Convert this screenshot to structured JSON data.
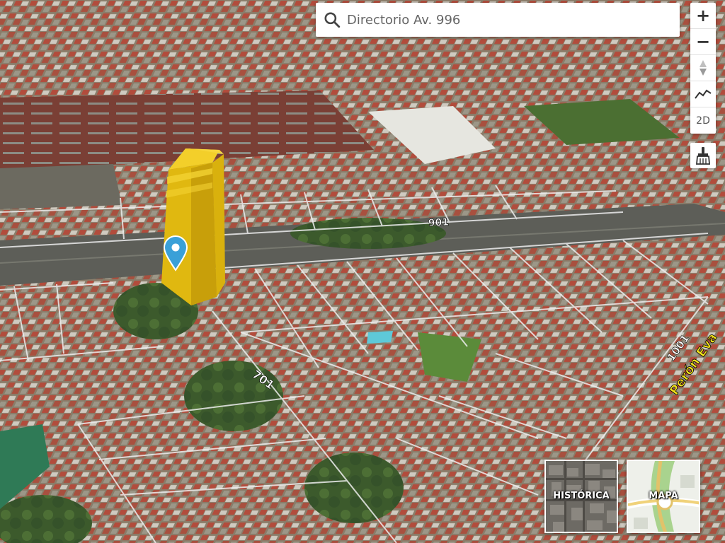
{
  "search": {
    "placeholder": "Directorio Av. 996"
  },
  "controls": {
    "zoom_in": "+",
    "zoom_out": "−",
    "mode_2d": "2D"
  },
  "map": {
    "labels": {
      "street_number_901": "901",
      "street_number_701": "701",
      "street_number_1001": "1001",
      "street_name": "Perón Eva"
    }
  },
  "layers": {
    "historica": "HISTÓRICA",
    "mapa": "MAPA"
  },
  "colors": {
    "highlight_building": "#e9c012",
    "pin": "#3aa0d8",
    "parcel_lines": "#e8e8e8"
  }
}
